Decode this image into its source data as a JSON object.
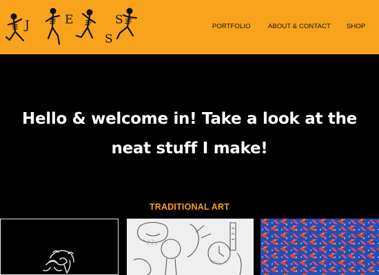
{
  "header": {
    "logo_letters": [
      "J",
      "E",
      "S",
      "S"
    ],
    "background_color": "#f9a21b",
    "nav": [
      {
        "label": "PORTFOLIO"
      },
      {
        "label": "ABOUT & CONTACT"
      },
      {
        "label": "SHOP"
      }
    ]
  },
  "hero": {
    "title": "Hello & welcome in! Take a look at the neat stuff I make!"
  },
  "gallery": {
    "section_title": "TRADITIONAL ART",
    "accent_color": "#f9a21b",
    "items": [
      {
        "subject": "ink portrait"
      },
      {
        "subject": "pencil still life"
      },
      {
        "subject": "woven textile"
      }
    ]
  }
}
